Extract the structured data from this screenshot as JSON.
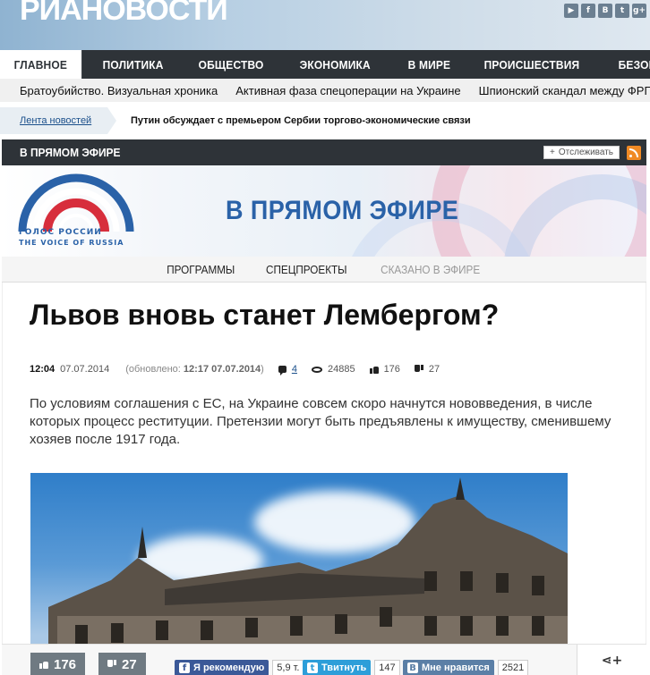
{
  "header": {
    "logo": "РИАНОВОСТИ",
    "social": [
      {
        "name": "youtube-icon",
        "glyph": "▶"
      },
      {
        "name": "facebook-icon",
        "glyph": "f"
      },
      {
        "name": "vk-icon",
        "glyph": "B"
      },
      {
        "name": "twitter-icon",
        "glyph": "t"
      },
      {
        "name": "googleplus-icon",
        "glyph": "g+"
      }
    ]
  },
  "nav": {
    "items": [
      "ГЛАВНОЕ",
      "ПОЛИТИКА",
      "ОБЩЕСТВО",
      "ЭКОНОМИКА",
      "В МИРЕ",
      "ПРОИСШЕСТВИЯ",
      "БЕЗОПАСНОСТЬ"
    ],
    "active": 0
  },
  "subnav": {
    "items": [
      "Братоубийство. Визуальная хроника",
      "Активная фаза спецоперации на Украине",
      "Шпионский скандал между ФРГ"
    ]
  },
  "ticker": {
    "tag": "Лента новостей",
    "text": "Путин обсуждает с премьером Сербии торгово-экономические связи"
  },
  "live": {
    "title": "В ПРЯМОМ ЭФИРЕ",
    "follow_label": "Отслеживать",
    "banner_title": "В ПРЯМОМ ЭФИРЕ",
    "banner_logo_line1": "ГОЛОС РОССИИ",
    "banner_logo_line2": "THE VOICE OF RUSSIA",
    "sections": [
      "ПРОГРАММЫ",
      "СПЕЦПРОЕКТЫ",
      "СКАЗАНО В ЭФИРЕ"
    ]
  },
  "article": {
    "headline": "Львов вновь станет Лембергом?",
    "time": "12:04",
    "date": "07.07.2014",
    "updated_prefix": "(обновлено: ",
    "updated_time": "12:17 07.07.2014",
    "updated_suffix": ")",
    "comments": "4",
    "views": "24885",
    "likes": "176",
    "dislikes": "27",
    "lead": "По условиям соглашения с ЕС, на Украине совсем скоро начнутся нововведения, в числе которых процесс реституции. Претензии могут быть предъявлены к имуществу, сменившему хозяев после 1917 года."
  },
  "sharebar": {
    "likes": "176",
    "dislikes": "27",
    "fb_label": "Я рекомендую",
    "fb_count": "5,9 т.",
    "tw_label": "Твитнуть",
    "tw_count": "147",
    "vk_label": "Мне нравится",
    "vk_count": "2521",
    "more_glyph": "⋖+"
  },
  "colors": {
    "nav_bg": "#2e3338",
    "brand_blue": "#2a62a8",
    "fb": "#3b5998",
    "tw": "#2d9ed9",
    "vk": "#5b7fa6",
    "rss": "#f08a24"
  }
}
